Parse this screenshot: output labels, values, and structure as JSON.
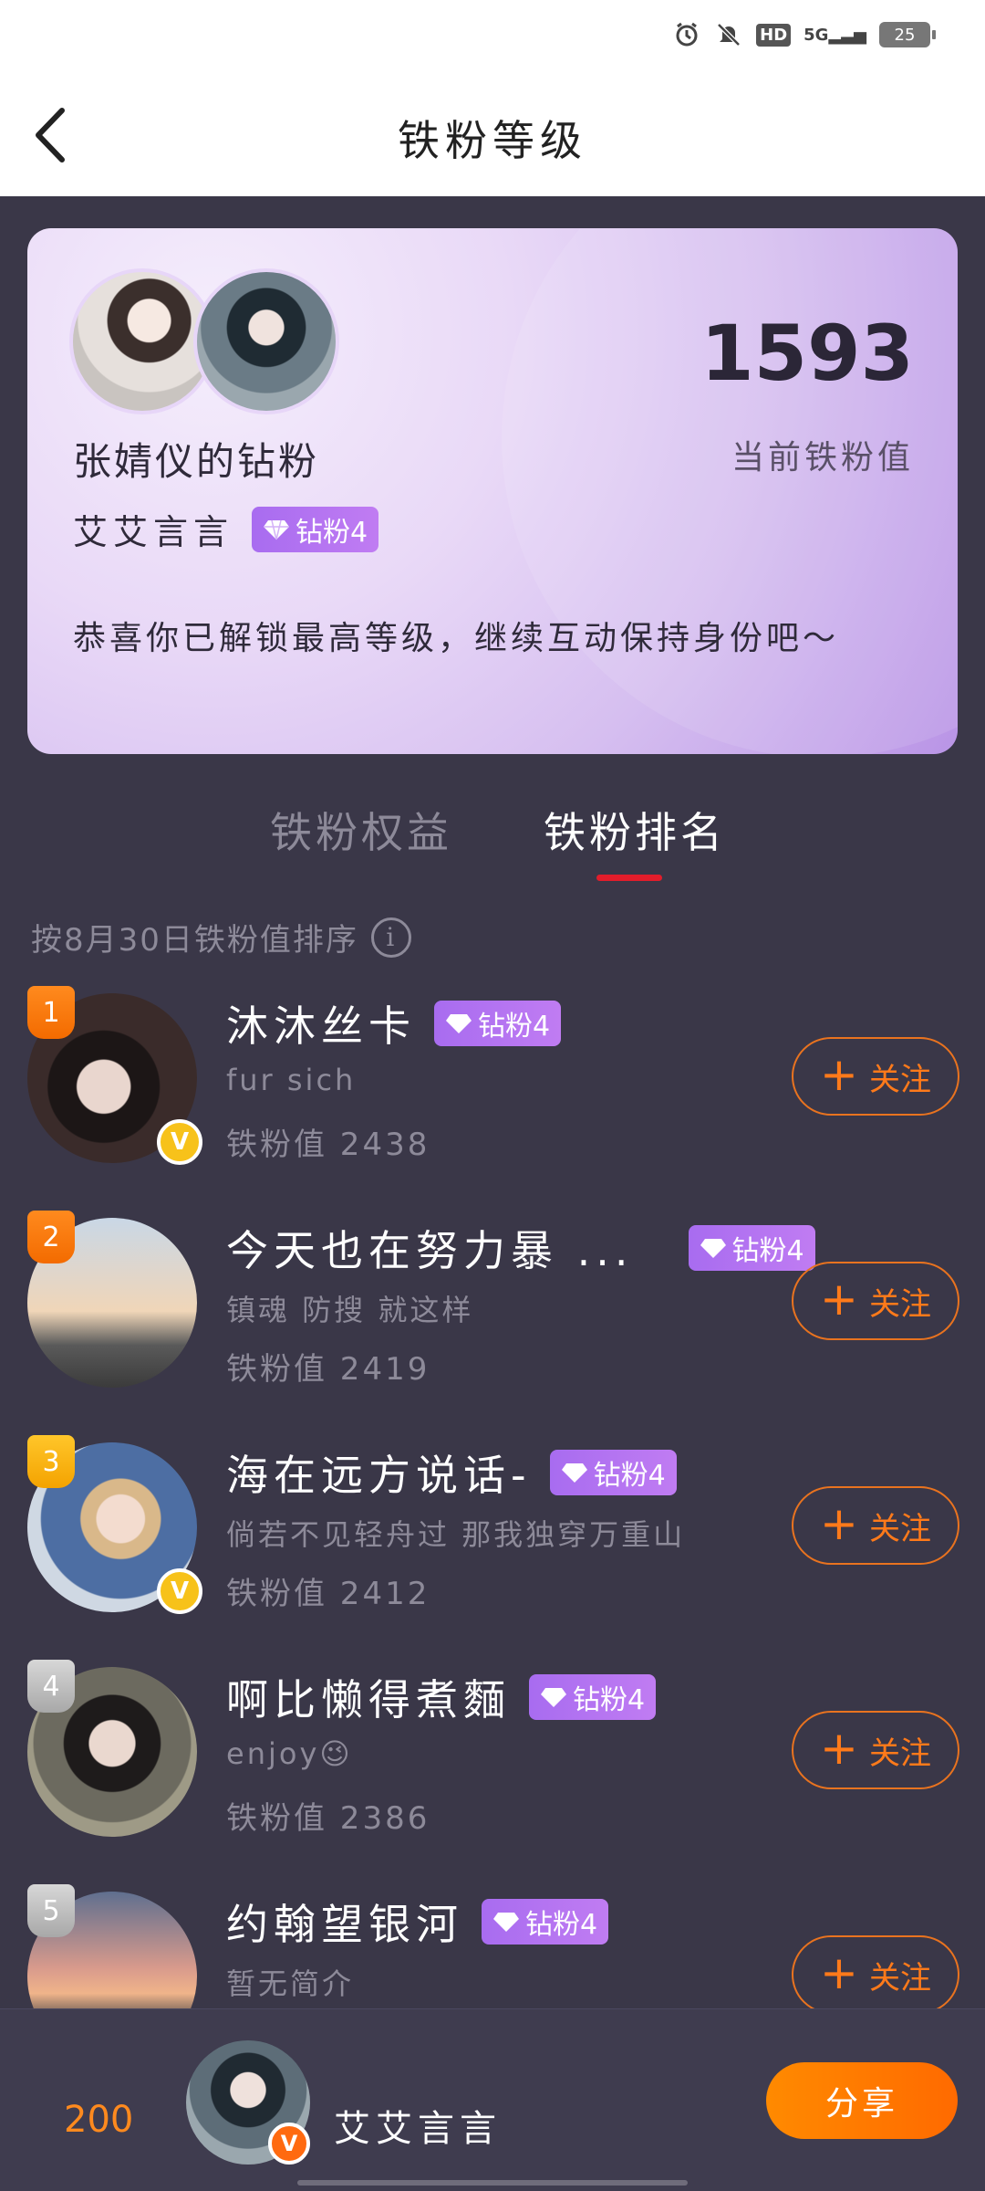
{
  "status": {
    "network": "5G",
    "hd": "HD",
    "battery": "25"
  },
  "header": {
    "title": "铁粉等级"
  },
  "card": {
    "fan_title": "张婧仪的钻粉",
    "user_name": "艾艾言言",
    "badge": "钻粉4",
    "score": "1593",
    "score_label": "当前铁粉值",
    "congrats": "恭喜你已解锁最高等级，继续互动保持身份吧～"
  },
  "tabs": {
    "benefits": "铁粉权益",
    "ranking": "铁粉排名"
  },
  "sort_note": "按8月30日铁粉值排序",
  "follow_label": "关注",
  "rows": [
    {
      "rank": "1",
      "name": "沐沐丝卡",
      "badge": "钻粉4",
      "bio": "fur sich",
      "score": "铁粉值 2438"
    },
    {
      "rank": "2",
      "name": "今天也在努力暴 ...",
      "badge": "钻粉4",
      "bio": "镇魂 防搜 就这样",
      "score": "铁粉值 2419"
    },
    {
      "rank": "3",
      "name": "海在远方说话-",
      "badge": "钻粉4",
      "bio": "倘若不见轻舟过 那我独穿万重山",
      "score": "铁粉值 2412"
    },
    {
      "rank": "4",
      "name": "啊比懒得煮麵",
      "badge": "钻粉4",
      "bio": "enjoy😉",
      "score": "铁粉值 2386"
    },
    {
      "rank": "5",
      "name": "约翰望银河",
      "badge": "钻粉4",
      "bio": "暂无简介",
      "score": ""
    }
  ],
  "bottom": {
    "rank": "200",
    "name": "艾艾言言",
    "share": "分享"
  },
  "colors": {
    "accent": "#ff7a1a",
    "badge": "#b074f0",
    "tab_indicator": "#e21d2b",
    "background": "#3a3748"
  }
}
